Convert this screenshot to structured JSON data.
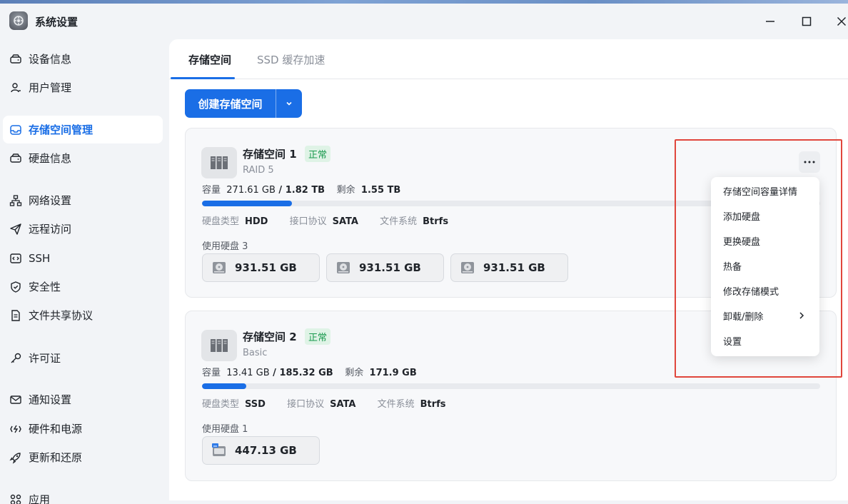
{
  "app": {
    "title": "系统设置"
  },
  "sidebar": {
    "items": [
      {
        "label": "设备信息",
        "icon": "drive-icon"
      },
      {
        "label": "用户管理",
        "icon": "user-icon"
      },
      {
        "label": "存储空间管理",
        "icon": "inbox-icon",
        "active": true
      },
      {
        "label": "硬盘信息",
        "icon": "drive-icon"
      },
      {
        "label": "网络设置",
        "icon": "network-icon"
      },
      {
        "label": "远程访问",
        "icon": "send-icon"
      },
      {
        "label": "SSH",
        "icon": "code-icon"
      },
      {
        "label": "安全性",
        "icon": "shield-icon"
      },
      {
        "label": "文件共享协议",
        "icon": "file-icon"
      },
      {
        "label": "许可证",
        "icon": "key-icon"
      },
      {
        "label": "通知设置",
        "icon": "mail-icon"
      },
      {
        "label": "硬件和电源",
        "icon": "power-icon"
      },
      {
        "label": "更新和还原",
        "icon": "rocket-icon"
      },
      {
        "label": "应用",
        "icon": "apps-icon"
      }
    ]
  },
  "tabs": [
    {
      "label": "存储空间",
      "active": true
    },
    {
      "label": "SSD 缓存加速",
      "active": false
    }
  ],
  "create_button": {
    "label": "创建存储空间"
  },
  "pools": [
    {
      "name": "存储空间 1",
      "status": "正常",
      "raid": "RAID 5",
      "capacity_label": "容量",
      "used": "271.61 GB",
      "separator": " / ",
      "total": "1.82 TB",
      "free_label": "剩余",
      "free": "1.55 TB",
      "usage_fraction": 0.145,
      "meta": [
        {
          "k": "硬盘类型",
          "v": "HDD"
        },
        {
          "k": "接口协议",
          "v": "SATA"
        },
        {
          "k": "文件系统",
          "v": "Btrfs"
        }
      ],
      "disks_label": "使用硬盘 3",
      "disks": [
        "931.51 GB",
        "931.51 GB",
        "931.51 GB"
      ]
    },
    {
      "name": "存储空间 2",
      "status": "正常",
      "raid": "Basic",
      "capacity_label": "容量",
      "used": "13.41 GB",
      "separator": " / ",
      "total": "185.32 GB",
      "free_label": "剩余",
      "free": "171.9 GB",
      "usage_fraction": 0.072,
      "meta": [
        {
          "k": "硬盘类型",
          "v": "SSD"
        },
        {
          "k": "接口协议",
          "v": "SATA"
        },
        {
          "k": "文件系统",
          "v": "Btrfs"
        }
      ],
      "disks_label": "使用硬盘 1",
      "disks": [
        "447.13 GB"
      ]
    }
  ],
  "context_menu": {
    "items": [
      {
        "label": "存储空间容量详情"
      },
      {
        "label": "添加硬盘"
      },
      {
        "label": "更换硬盘"
      },
      {
        "label": "热备"
      },
      {
        "label": "修改存储模式"
      },
      {
        "label": "卸载/删除",
        "submenu": true
      },
      {
        "label": "设置"
      }
    ]
  },
  "colors": {
    "accent": "#1a6ee6",
    "status_ok": "#1a9a4e",
    "highlight": "#e0463c"
  }
}
